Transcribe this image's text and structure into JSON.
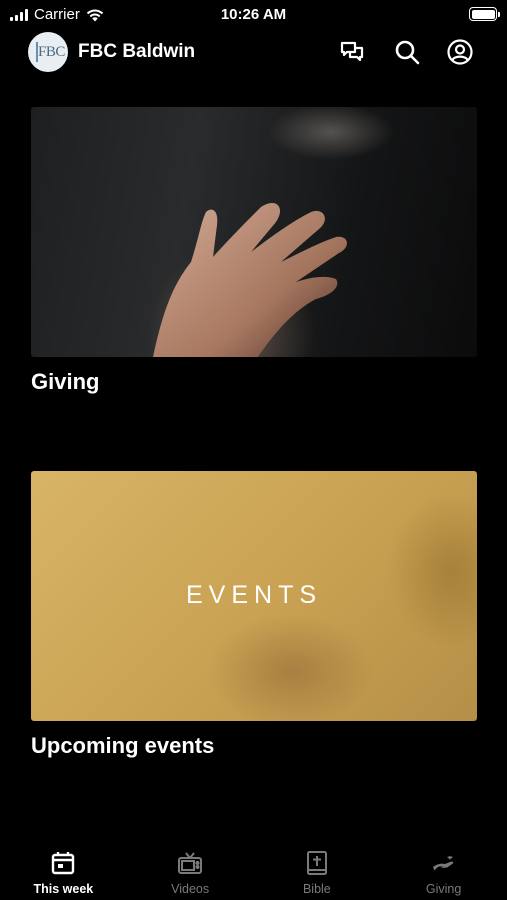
{
  "status_bar": {
    "carrier": "Carrier",
    "time": "10:26 AM"
  },
  "header": {
    "app_title": "FBC Baldwin",
    "logo_text": "FBC",
    "icons": [
      "chat-icon",
      "search-icon",
      "account-icon"
    ]
  },
  "cards": [
    {
      "title": "Giving",
      "image": "open-hand-photo"
    },
    {
      "title": "Upcoming events",
      "image": "events-photo",
      "overlay_text": "EVENTS"
    }
  ],
  "tabs": [
    {
      "label": "This week",
      "icon": "calendar-icon",
      "active": true
    },
    {
      "label": "Videos",
      "icon": "tv-icon",
      "active": false
    },
    {
      "label": "Bible",
      "icon": "bible-icon",
      "active": false
    },
    {
      "label": "Giving",
      "icon": "giving-hand-icon",
      "active": false
    }
  ],
  "colors": {
    "background": "#000000",
    "text": "#ffffff",
    "inactive_tab": "#7a7a7a",
    "events_gold": "#c9a152"
  }
}
